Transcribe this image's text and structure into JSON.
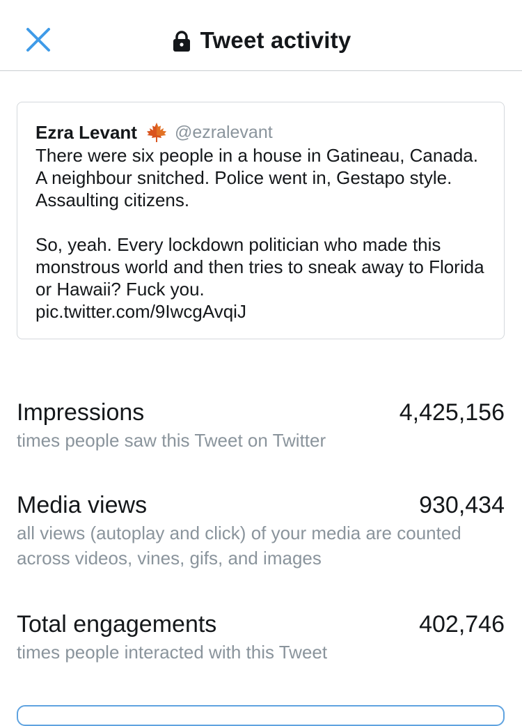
{
  "header": {
    "title": "Tweet activity",
    "close_icon": "close-icon",
    "lock_icon": "lock-icon"
  },
  "tweet": {
    "author_name": "Ezra Levant",
    "author_emoji": "maple-leaf-icon",
    "author_handle": "@ezralevant",
    "text": "There were six people in a house in Gatineau, Canada. A neighbour snitched. Police went in, Gestapo style. Assaulting citizens.\n\nSo, yeah. Every lockdown politician who made this monstrous world and then tries to sneak away to Florida or Hawaii? Fuck you.\npic.twitter.com/9IwcgAvqiJ"
  },
  "metrics": [
    {
      "label": "Impressions",
      "value": "4,425,156",
      "description": "times people saw this Tweet on Twitter"
    },
    {
      "label": "Media views",
      "value": "930,434",
      "description": "all views (autoplay and click) of your media are counted across videos, vines, gifs, and images"
    },
    {
      "label": "Total engagements",
      "value": "402,746",
      "description": "times people interacted with this Tweet"
    }
  ],
  "colors": {
    "accent": "#1da1f2",
    "text_primary": "#14171a",
    "text_secondary": "#8a949c",
    "border": "#d4d8dc"
  }
}
